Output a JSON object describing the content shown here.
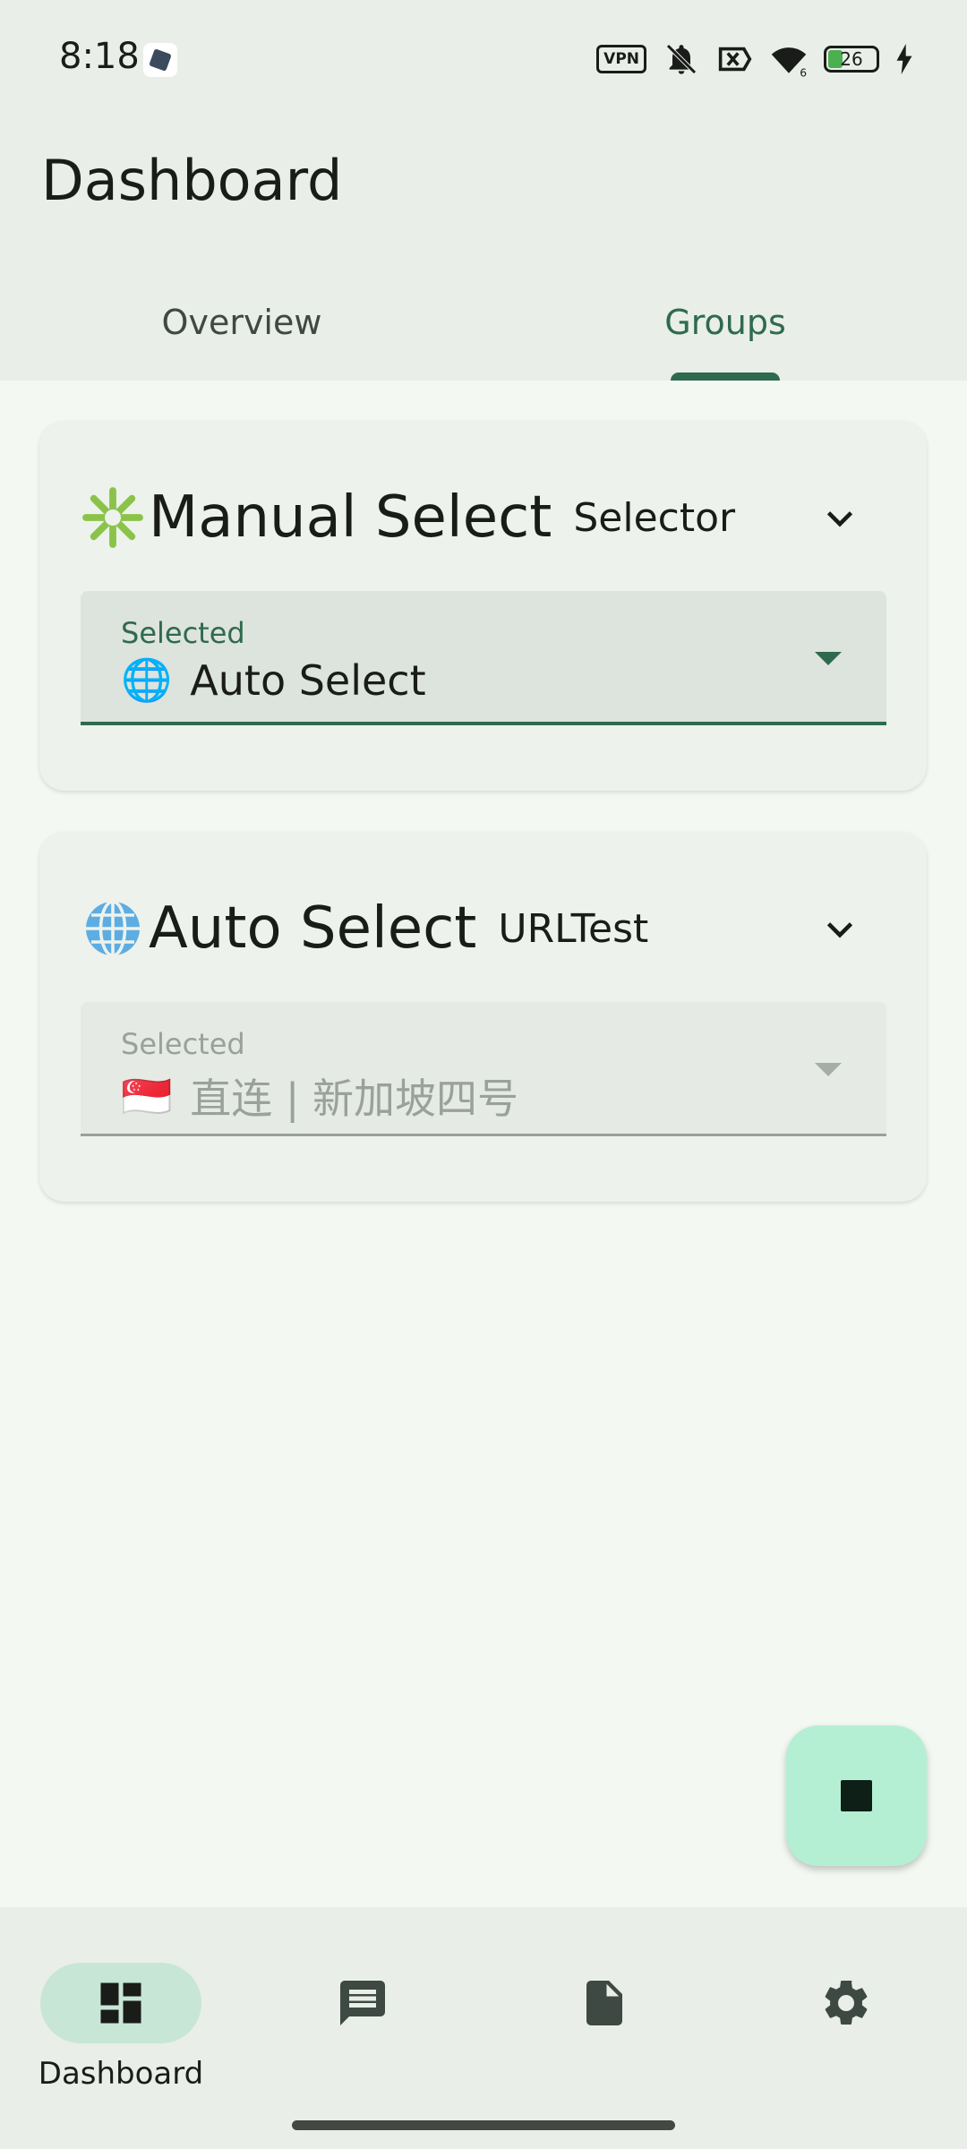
{
  "status_bar": {
    "time": "8:18",
    "vpn_label": "VPN",
    "battery_level": "26",
    "icons": [
      "app-notification-icon",
      "vpn-icon",
      "mute-icon",
      "no-sim-icon",
      "wifi-icon",
      "battery-icon",
      "charging-icon"
    ]
  },
  "header": {
    "title": "Dashboard",
    "tabs": [
      {
        "label": "Overview",
        "selected": false
      },
      {
        "label": "Groups",
        "selected": true
      }
    ]
  },
  "groups": [
    {
      "icon": "sparkle-icon",
      "name": "Manual Select",
      "type": "Selector",
      "selected_label": "Selected",
      "selected_flag": "🌐",
      "selected_value": "Auto Select",
      "enabled": true
    },
    {
      "icon": "globe-icon",
      "name": "Auto Select",
      "type": "URLTest",
      "selected_label": "Selected",
      "selected_flag": "🇸🇬",
      "selected_value": "直连 | 新加坡四号",
      "enabled": false
    }
  ],
  "fab": {
    "icon": "stop-icon"
  },
  "bottom_nav": [
    {
      "label": "Dashboard",
      "icon": "dashboard-icon",
      "active": true
    },
    {
      "label": "",
      "icon": "message-icon",
      "active": false
    },
    {
      "label": "",
      "icon": "document-icon",
      "active": false
    },
    {
      "label": "",
      "icon": "settings-icon",
      "active": false
    }
  ],
  "colors": {
    "accent": "#2F6A4E",
    "fab": "#B5EFD3",
    "background": "#F3F8F2"
  }
}
